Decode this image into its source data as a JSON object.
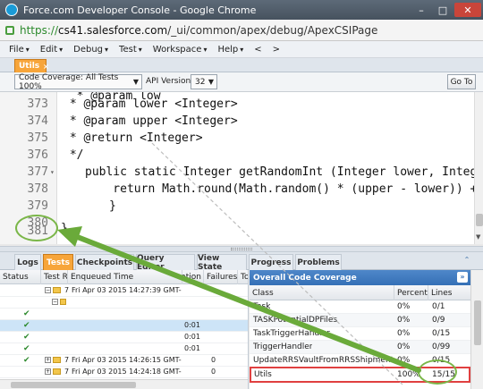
{
  "window": {
    "title": "Force.com Developer Console - Google Chrome",
    "buttons": [
      "–",
      "□",
      "✕"
    ]
  },
  "urlbar": {
    "scheme": "https://",
    "host": "cs41.salesforce.com",
    "path": "/_ui/common/apex/debug/ApexCSIPage"
  },
  "menu": {
    "items": [
      "File",
      "Edit",
      "Debug",
      "Test",
      "Workspace",
      "Help",
      "<",
      ">"
    ]
  },
  "file_tab": {
    "label": "Utils",
    "close": "×"
  },
  "toolbar": {
    "coverage_select": "Code Coverage: All Tests 100%",
    "api_label": "API Version:",
    "api_value": "32",
    "goto_label": "Go To"
  },
  "editor": {
    "lines": [
      {
        "num": "373",
        "code": " * @param lower <Integer>",
        "type": "comment"
      },
      {
        "num": "374",
        "code": " * @param upper <Integer>",
        "type": "comment"
      },
      {
        "num": "375",
        "code": " * @return <Integer>",
        "type": "comment"
      },
      {
        "num": "376",
        "code": " */",
        "type": "comment"
      },
      {
        "num": "377",
        "code": "public static Integer getRandomInt (Integer lower, Integer u",
        "type": "code"
      },
      {
        "num": "378",
        "code": "    return Math.round(Math.random() * (upper - lower)) + low",
        "type": "code"
      },
      {
        "num": "379",
        "code": "}",
        "type": "code"
      },
      {
        "num": "380",
        "code": "",
        "type": "code"
      },
      {
        "num": "381",
        "code": "}",
        "type": "code"
      }
    ]
  },
  "bottom_tabs": [
    "Logs",
    "Tests",
    "Checkpoints",
    "Query Editor",
    "View State",
    "Progress",
    "Problems"
  ],
  "tests": {
    "columns": [
      "Status",
      "Test Run",
      "Enqueued Time",
      "Duration",
      "Failures",
      "To"
    ],
    "rows": [
      {
        "status": "",
        "run": "7",
        "time": "Fri Apr 03 2015 14:27:39 GMT-",
        "duration": "",
        "failures": "",
        "kind": "run"
      },
      {
        "status": "",
        "run": "",
        "time": "",
        "duration": "",
        "failures": "",
        "kind": "class"
      },
      {
        "status": "✔",
        "run": "",
        "time": "",
        "duration": "",
        "failures": "",
        "kind": "test"
      },
      {
        "status": "✔",
        "run": "",
        "time": "",
        "duration": "0:01",
        "failures": "",
        "kind": "test"
      },
      {
        "status": "✔",
        "run": "",
        "time": "",
        "duration": "0:01",
        "failures": "",
        "kind": "test"
      },
      {
        "status": "✔",
        "run": "",
        "time": "",
        "duration": "0:01",
        "failures": "",
        "kind": "test"
      },
      {
        "status": "✔",
        "run": "7",
        "time": "Fri Apr 03 2015 14:26:15 GMT-",
        "duration": "",
        "failures": "0",
        "kind": "run"
      },
      {
        "status": "",
        "run": "7",
        "time": "Fri Apr 03 2015 14:24:18 GMT-",
        "duration": "",
        "failures": "0",
        "kind": "run"
      }
    ]
  },
  "coverage": {
    "title": "Overall Code Coverage",
    "columns": [
      "Class",
      "Percent",
      "Lines"
    ],
    "rows": [
      {
        "class": "Task",
        "percent": "0%",
        "lines": "0/1"
      },
      {
        "class": "TASKPotentialDPFiles",
        "percent": "0%",
        "lines": "0/9"
      },
      {
        "class": "TaskTriggerHandler",
        "percent": "0%",
        "lines": "0/15"
      },
      {
        "class": "TriggerHandler",
        "percent": "0%",
        "lines": "0/99"
      },
      {
        "class": "UpdateRRSVaultFromRRSShipment",
        "percent": "0%",
        "lines": "0/15"
      },
      {
        "class": "Utils",
        "percent": "100%",
        "lines": "15/15"
      }
    ]
  },
  "colors": {
    "accent_orange": "#f7a53a",
    "coverage_blue": "#3570b6",
    "annotation_green": "#6aaa3a",
    "annotation_red": "#e04040"
  }
}
